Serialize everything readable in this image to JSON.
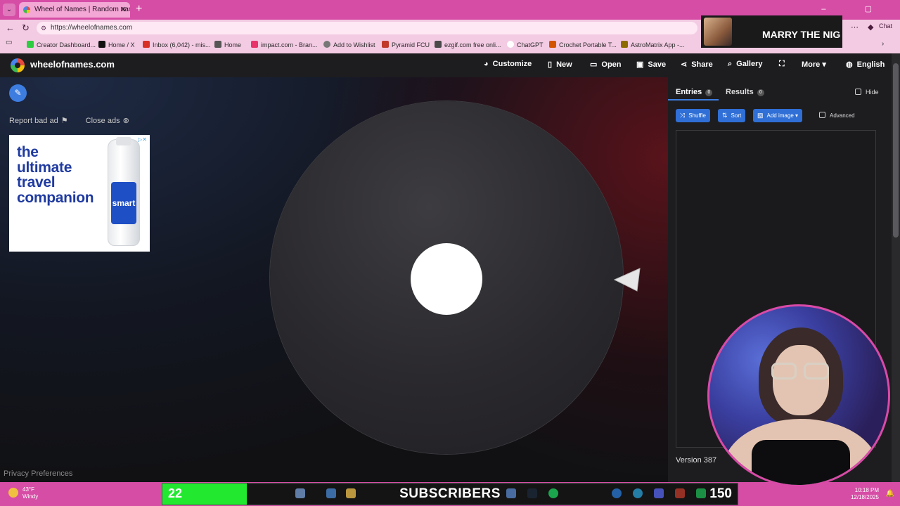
{
  "browser": {
    "tab_title": "Wheel of Names | Random name p",
    "url": "https://wheelofnames.com",
    "chat_label": "Chat",
    "bookmarks": [
      {
        "label": "Creator Dashboard...",
        "color": "#2ecc40"
      },
      {
        "label": "Home / X",
        "color": "#111111"
      },
      {
        "label": "Inbox (6,042) - mis...",
        "color": "#d93025"
      },
      {
        "label": "Home",
        "color": "#555555"
      },
      {
        "label": "impact.com - Bran...",
        "color": "#e8336b"
      },
      {
        "label": "Add to Wishlist",
        "color": "#777777"
      },
      {
        "label": "Pyramid FCU",
        "color": "#c0392b"
      },
      {
        "label": "ezgif.com free onli...",
        "color": "#4a4a4a"
      },
      {
        "label": "ChatGPT",
        "color": "#ffffff"
      },
      {
        "label": "Crochet Portable T...",
        "color": "#d35400"
      },
      {
        "label": "AstroMatrix App -...",
        "color": "#8e6b00"
      }
    ]
  },
  "site": {
    "logo_text": "wheelofnames.com",
    "nav": [
      "Customize",
      "New",
      "Open",
      "Save",
      "Share",
      "Gallery",
      "",
      "More",
      "English"
    ]
  },
  "ad": {
    "report_label": "Report bad ad",
    "close_label": "Close ads",
    "headline": "the\nultimate\ntravel\ncompanion",
    "brand": "smart"
  },
  "privacy_label": "Privacy Preferences",
  "panel": {
    "entries_label": "Entries",
    "entries_count": "0",
    "results_label": "Results",
    "results_count": "0",
    "hide_label": "Hide",
    "shuffle_label": "Shuffle",
    "sort_label": "Sort",
    "add_image_label": "Add image",
    "advanced_label": "Advanced",
    "version": "Version 387"
  },
  "overlay": {
    "notification_text": "MARRY THE NIG",
    "subscriber_current": "22",
    "subscriber_label": "SUBSCRIBERS",
    "subscriber_goal": "150",
    "subscriber_progress": 0.1467
  },
  "taskbar": {
    "weather_temp": "43°F",
    "weather_desc": "Windy",
    "time": "10:18 PM",
    "date": "12/18/2025"
  }
}
